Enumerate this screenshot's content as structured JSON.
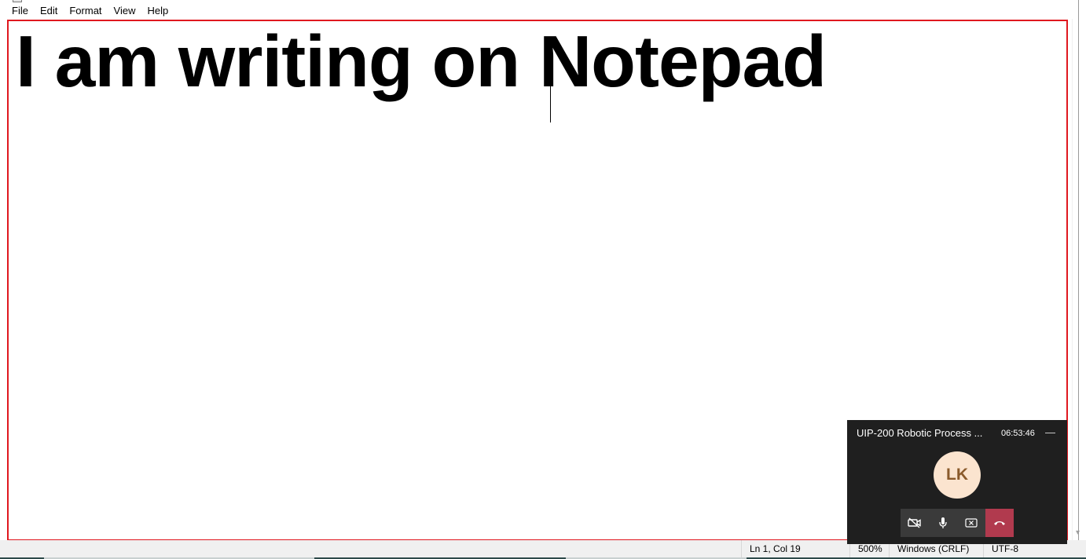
{
  "menu": {
    "file": "File",
    "edit": "Edit",
    "format": "Format",
    "view": "View",
    "help": "Help"
  },
  "editor": {
    "text": "I am writing on Notepad"
  },
  "status": {
    "position": "Ln 1, Col 19",
    "zoom": "500%",
    "line_ending": "Windows (CRLF)",
    "encoding": "UTF-8"
  },
  "call": {
    "title": "UIP-200 Robotic Process ...",
    "time": "06:53:46",
    "minimize": "—",
    "avatar_initials": "LK",
    "controls": [
      "camera-off-icon",
      "microphone-icon",
      "share-screen-icon",
      "hang-up-icon"
    ]
  },
  "colors": {
    "highlight_border": "#e0181f",
    "call_background": "#1f1f1f",
    "hangup": "#b13a4e",
    "avatar_bg": "#fbe4cf",
    "avatar_text": "#8a5a2b"
  }
}
